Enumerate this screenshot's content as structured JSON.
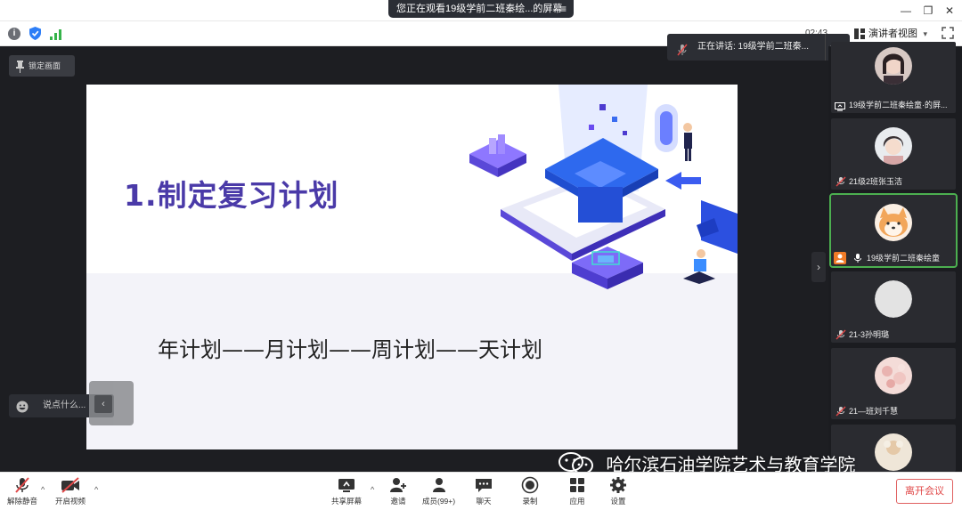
{
  "window": {
    "share_banner": "您正在观看19级学前二班秦绘...的屏幕",
    "menu_icon": "≡",
    "minimize": "—",
    "restore": "❐",
    "close": "✕"
  },
  "infobar": {
    "timer": "02:43",
    "view_mode": "演讲者视图",
    "view_caret": "▾"
  },
  "stage": {
    "lock_screen": "锁定画面",
    "speaking": "正在讲话: 19级学前二班秦...",
    "undo_icon": "↶",
    "chat_placeholder": "说点什么...",
    "collapse_icon": "‹",
    "panel_toggle": "›"
  },
  "slide": {
    "title": "1.制定复习计划",
    "subtitle": "年计划——月计划——周计划——天计划"
  },
  "participants": [
    {
      "name": "19级学前二班秦绘童·的屏...",
      "icon": "share-icon"
    },
    {
      "name": "21级2班张玉洁",
      "icon": "mic-muted-icon"
    },
    {
      "name": "19级学前二班秦绘童",
      "icon": "mic-icon"
    },
    {
      "name": "21-3孙明璐",
      "icon": "mic-muted-icon"
    },
    {
      "name": "21—班刘千慧",
      "icon": "mic-muted-icon"
    },
    {
      "name": "",
      "icon": ""
    }
  ],
  "toolbar": {
    "unmute": "解除静音",
    "start_video": "开启视频",
    "share_screen": "共享屏幕",
    "invite": "邀请",
    "members": "成员(99+)",
    "chat": "聊天",
    "record": "录制",
    "apps": "应用",
    "settings": "设置",
    "leave": "离开会议",
    "caret": "^"
  },
  "watermark": {
    "text": "哈尔滨石油学院艺术与教育学院"
  },
  "colors": {
    "accent_green": "#4caf50",
    "leave_red": "#e04848",
    "title_purple": "#4a3aa8",
    "stage_bg": "#1d1e22"
  }
}
